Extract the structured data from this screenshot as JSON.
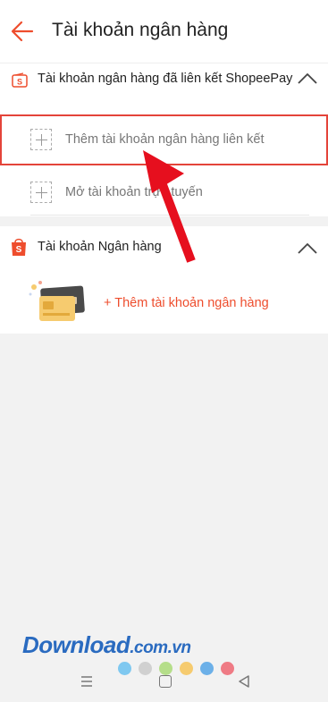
{
  "header": {
    "title": "Tài khoản ngân hàng",
    "back_icon": "arrow-left-icon"
  },
  "linked_section": {
    "title": "Tài khoản ngân hàng đã liên kết ShopeePay",
    "icon": "shopeepay-icon",
    "items": [
      {
        "label": "Thêm tài khoản ngân hàng liên kết",
        "icon": "plus-icon",
        "highlighted": true
      },
      {
        "label": "Mở tài khoản trực tuyến",
        "icon": "plus-icon",
        "highlighted": false
      }
    ]
  },
  "bank_section": {
    "title": "Tài khoản Ngân hàng",
    "icon": "shopee-bag-icon",
    "add_label": "+ Thêm tài khoản ngân hàng"
  },
  "watermark": {
    "main": "Download",
    "suffix": ".com.vn",
    "dot_colors": [
      "#7fc8f0",
      "#d0d0d0",
      "#b5de8a",
      "#f6cb6f",
      "#6cb0e8",
      "#ef7b85"
    ]
  },
  "colors": {
    "accent": "#ee4d2d",
    "highlight_border": "#e4443a",
    "watermark": "#2a6bc0"
  }
}
